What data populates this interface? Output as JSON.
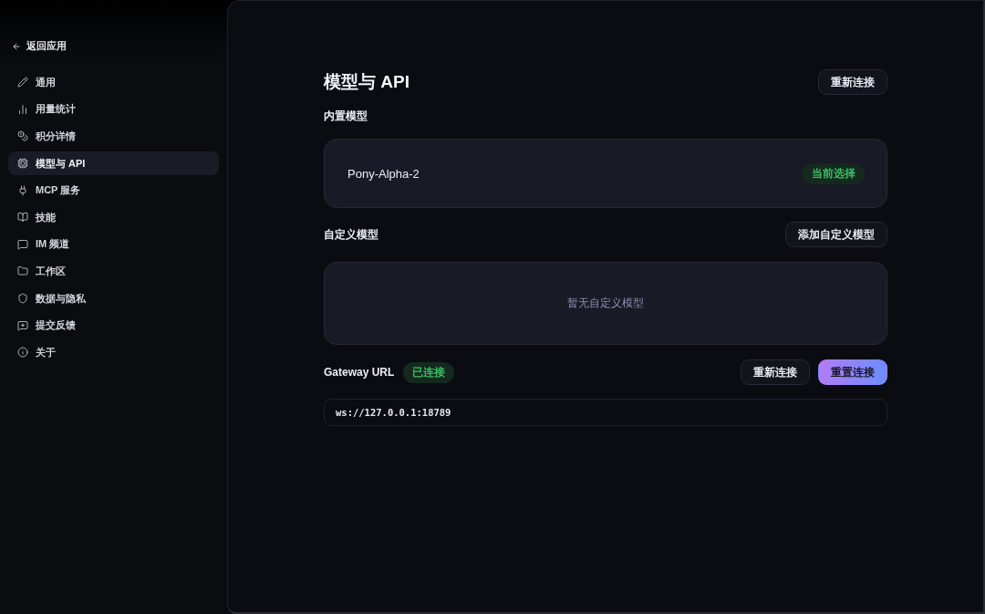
{
  "sidebar": {
    "back_link": {
      "label": "返回应用"
    },
    "items": [
      {
        "label": "通用",
        "selected": false
      },
      {
        "label": "用量统计",
        "selected": false
      },
      {
        "label": "积分详情",
        "selected": false
      },
      {
        "label": "模型与 API",
        "selected": true
      },
      {
        "label": "MCP 服务",
        "selected": false
      },
      {
        "label": "技能",
        "selected": false
      },
      {
        "label": "IM 频道",
        "selected": false
      },
      {
        "label": "工作区",
        "selected": false
      },
      {
        "label": "数据与隐私",
        "selected": false
      },
      {
        "label": "提交反馈",
        "selected": false
      },
      {
        "label": "关于",
        "selected": false
      }
    ]
  },
  "page": {
    "title": "模型与 API",
    "header_button": {
      "label": "重新连接"
    }
  },
  "builtin_models": {
    "title": "内置模型",
    "models": [
      {
        "name": "Pony-Alpha-2",
        "badge": "当前选择"
      }
    ]
  },
  "custom_models": {
    "title": "自定义模型",
    "add_button": {
      "label": "添加自定义模型"
    },
    "empty_text": "暂无自定义模型"
  },
  "gateway": {
    "label": "Gateway URL",
    "status": "已连接",
    "buttons": [
      {
        "label": "重新连接",
        "kind": "secondary"
      },
      {
        "label": "重置连接",
        "kind": "primary"
      }
    ],
    "url": "ws://127.0.0.1:18789"
  }
}
